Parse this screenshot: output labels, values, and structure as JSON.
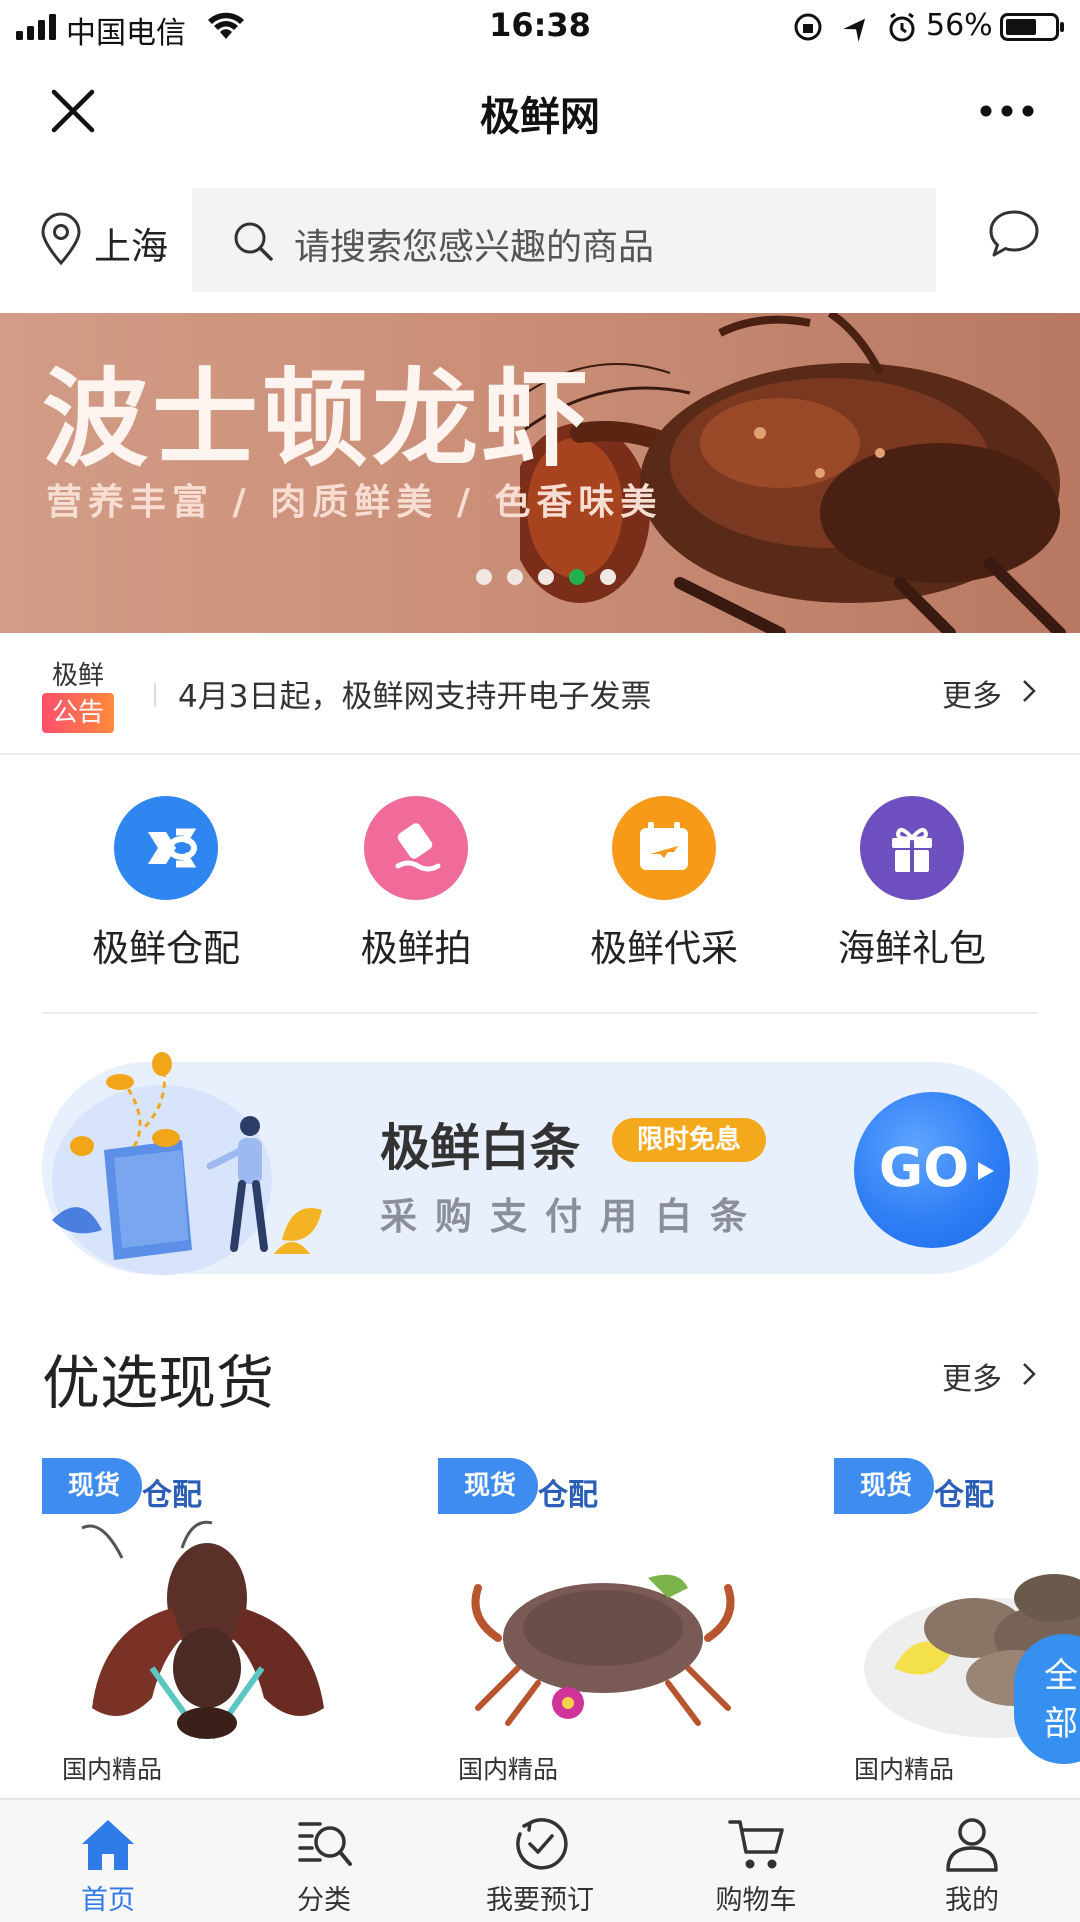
{
  "status_bar": {
    "carrier": "中国电信",
    "time": "16:38",
    "battery": "56%"
  },
  "nav": {
    "title": "极鲜网"
  },
  "location": {
    "city": "上海"
  },
  "search": {
    "placeholder": "请搜索您感兴趣的商品"
  },
  "banner": {
    "title": "波士顿龙虾",
    "subtitle": "营养丰富 / 肉质鲜美 / 色香味美",
    "dot_count": 5,
    "active_dot": 4,
    "active_dot_color": "#22b14c"
  },
  "notice": {
    "brand": "极鲜",
    "badge": "公告",
    "text": "4月3日起，极鲜网支持开电子发票",
    "more": "更多"
  },
  "quick_menu": [
    {
      "label": "极鲜仓配",
      "icon": "warehouse-delivery-icon",
      "color": "#2f86f0"
    },
    {
      "label": "极鲜拍",
      "icon": "auction-gavel-icon",
      "color": "#f06a9a"
    },
    {
      "label": "极鲜代采",
      "icon": "calendar-plane-icon",
      "color": "#f79a1a"
    },
    {
      "label": "海鲜礼包",
      "icon": "gift-icon",
      "color": "#6d4fc0"
    }
  ],
  "credit_banner": {
    "title": "极鲜白条",
    "tag": "限时免息",
    "subtitle": "采购支付用白条",
    "go": "GO"
  },
  "section": {
    "title": "优选现货",
    "more": "更多"
  },
  "products": [
    {
      "badge": "现货",
      "logo": "仓配",
      "label": "国内精品",
      "image": "lobster"
    },
    {
      "badge": "现货",
      "logo": "仓配",
      "label": "国内精品",
      "image": "crab"
    },
    {
      "badge": "现货",
      "logo": "仓配",
      "label": "国内精品",
      "image": "abalone"
    }
  ],
  "floating_button": {
    "label": "全部"
  },
  "tab_bar": [
    {
      "label": "首页",
      "icon": "home-icon",
      "active": true
    },
    {
      "label": "分类",
      "icon": "category-search-icon",
      "active": false
    },
    {
      "label": "我要预订",
      "icon": "check-circle-icon",
      "active": false
    },
    {
      "label": "购物车",
      "icon": "cart-icon",
      "active": false
    },
    {
      "label": "我的",
      "icon": "user-icon",
      "active": false
    }
  ],
  "colors": {
    "brand_blue": "#2f7be8",
    "notice_badge": "#ff5a5f",
    "credit_tag": "#f4a81c"
  }
}
